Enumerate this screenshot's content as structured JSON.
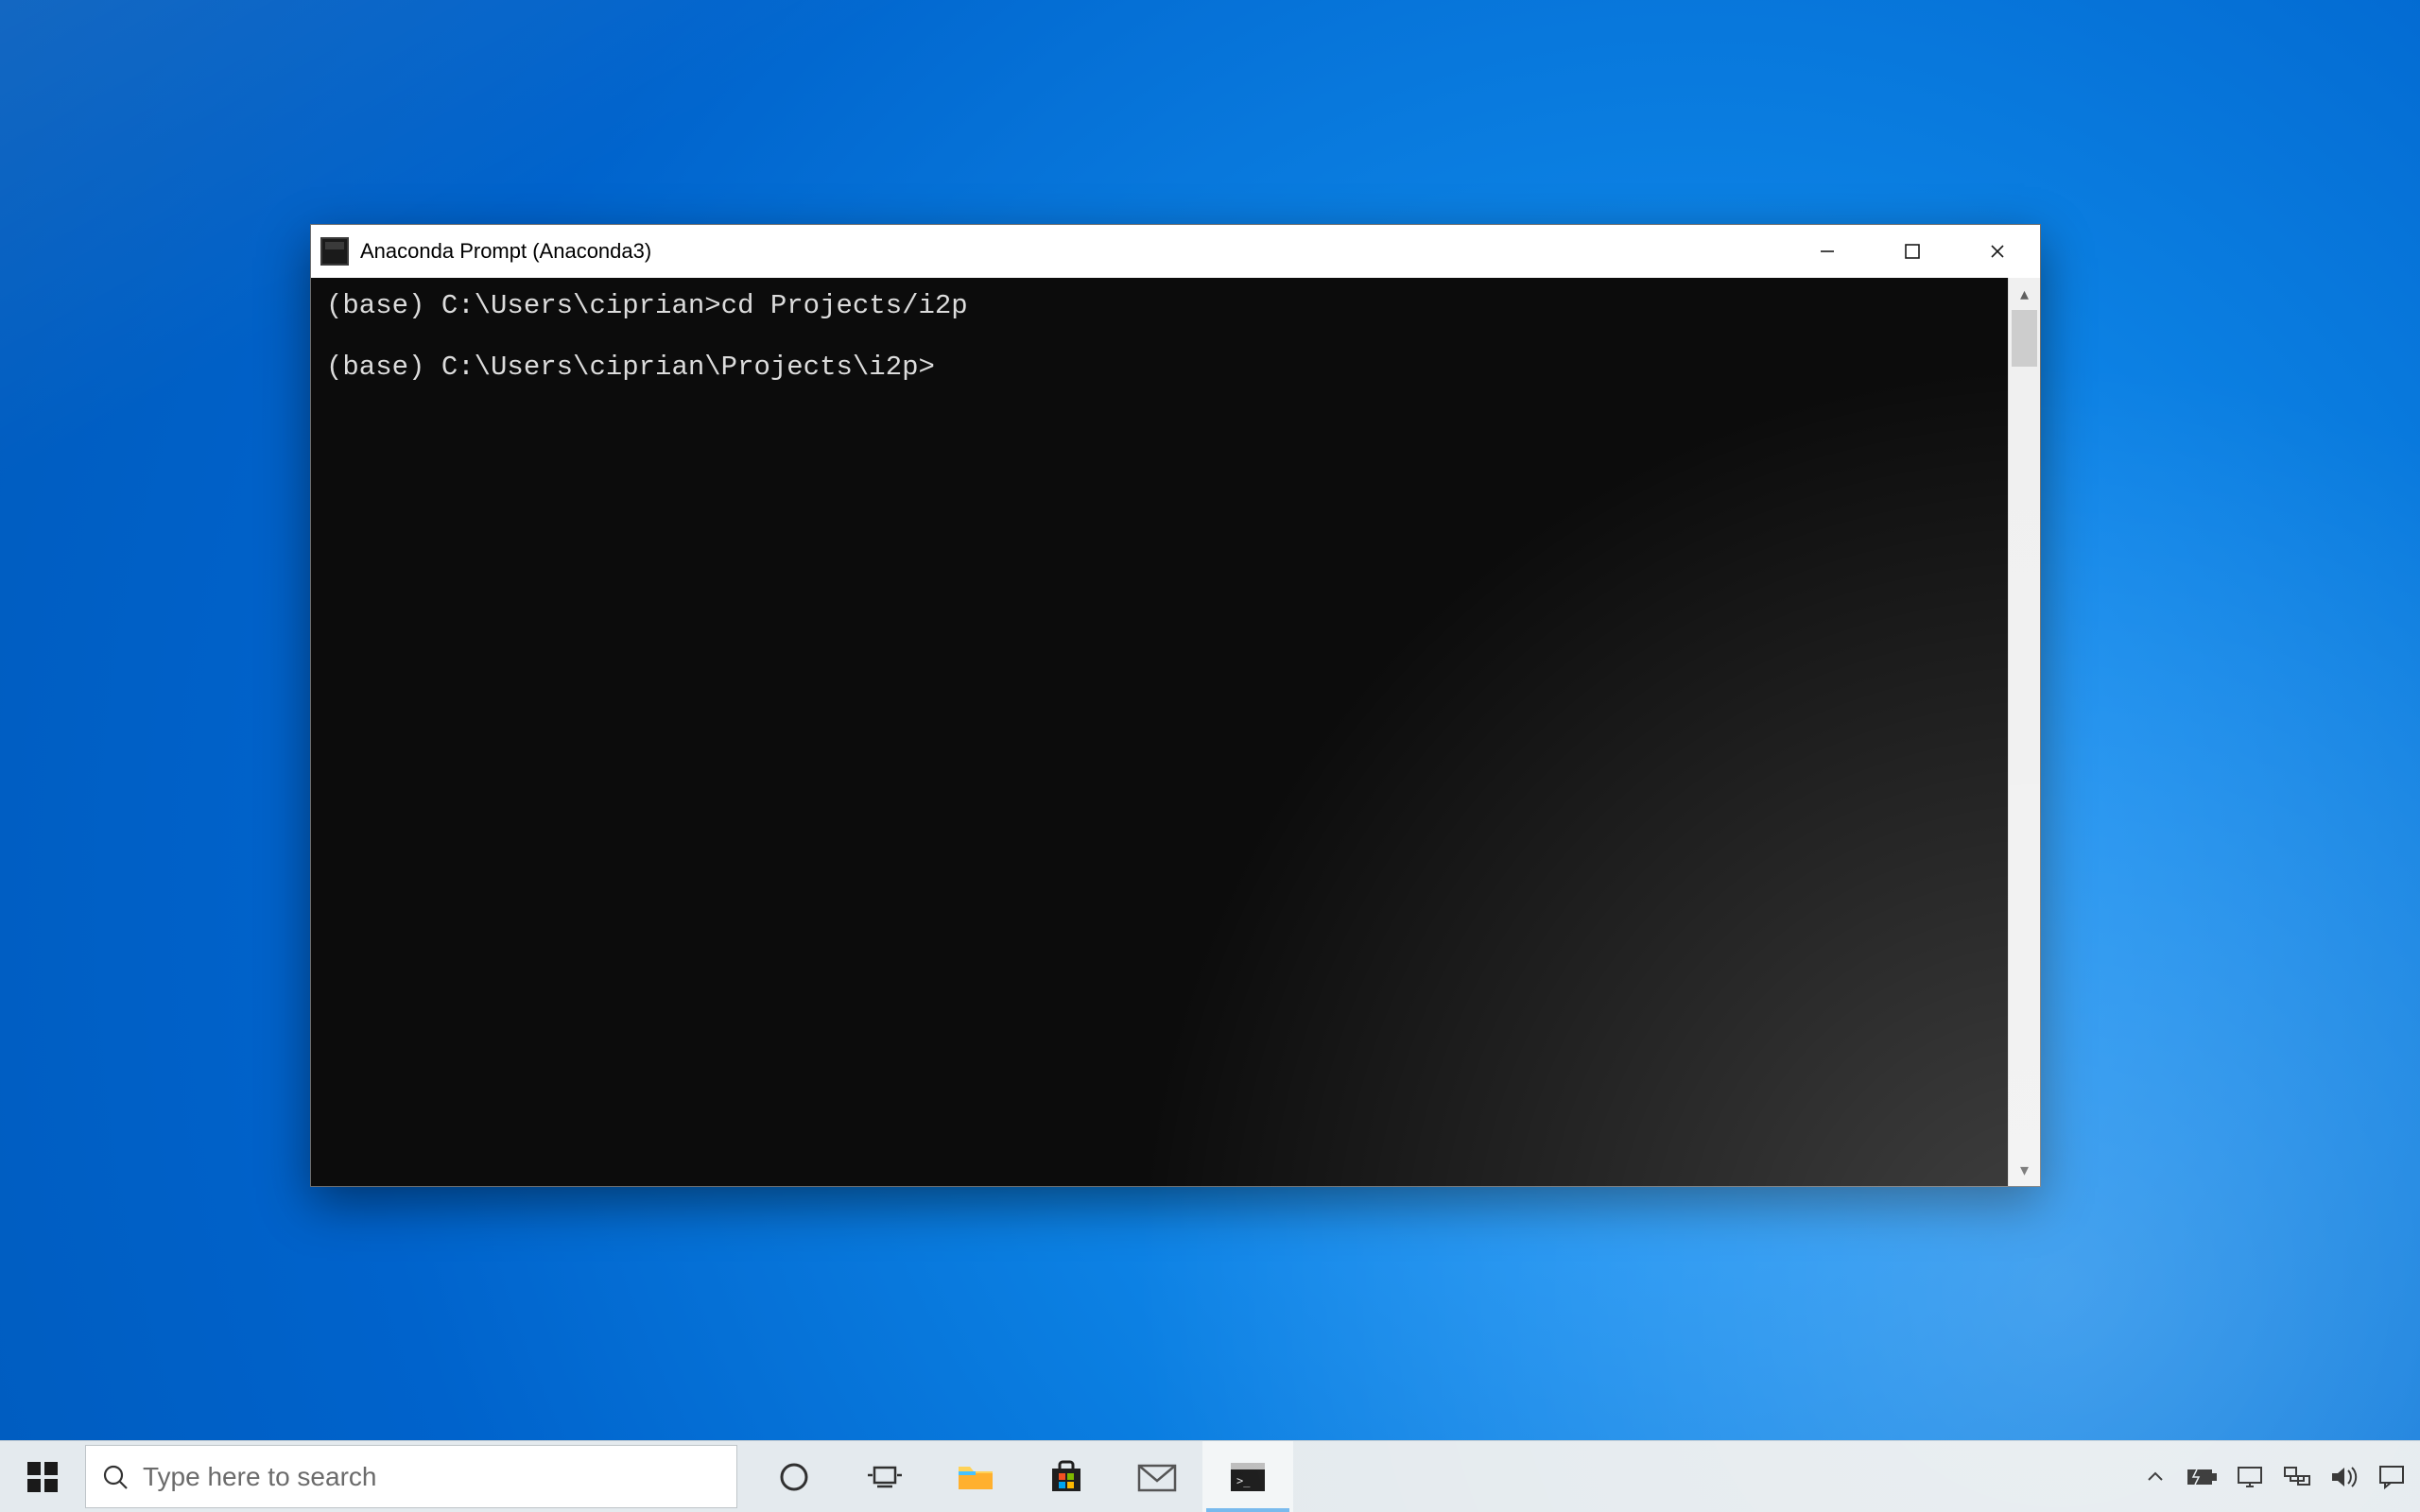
{
  "window": {
    "title": "Anaconda Prompt (Anaconda3)",
    "controls": {
      "minimize": "minimize",
      "maximize": "maximize",
      "close": "close"
    }
  },
  "terminal": {
    "lines": [
      "(base) C:\\Users\\ciprian>cd Projects/i2p",
      "",
      "(base) C:\\Users\\ciprian\\Projects\\i2p>"
    ]
  },
  "taskbar": {
    "search_placeholder": "Type here to search",
    "items": [
      {
        "name": "cortana",
        "active": false
      },
      {
        "name": "task-view",
        "active": false
      },
      {
        "name": "file-explorer",
        "active": false
      },
      {
        "name": "microsoft-store",
        "active": false
      },
      {
        "name": "mail",
        "active": false
      },
      {
        "name": "terminal",
        "active": true
      }
    ]
  },
  "tray": {
    "items": [
      "chevron-up",
      "battery",
      "monitor",
      "network",
      "volume",
      "action-center"
    ]
  }
}
